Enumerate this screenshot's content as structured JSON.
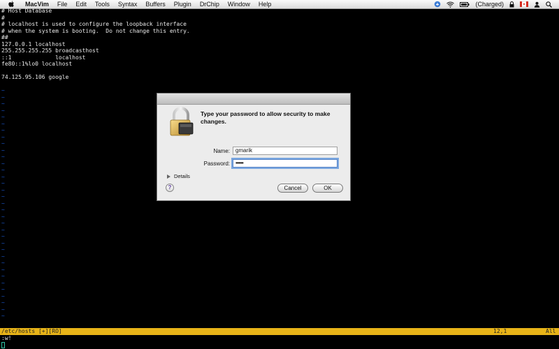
{
  "menubar": {
    "app_name": "MacVim",
    "items": [
      "File",
      "Edit",
      "Tools",
      "Syntax",
      "Buffers",
      "Plugin",
      "DrChip",
      "Window",
      "Help"
    ],
    "battery_text": "(Charged)"
  },
  "buffer": {
    "lines": [
      "# Host Database",
      "#",
      "# localhost is used to configure the loopback interface",
      "# when the system is booting.  Do not change this entry.",
      "##",
      "127.0.0.1 localhost",
      "255.255.255.255 broadcasthost",
      "::1             localhost",
      "fe80::1%lo0 localhost",
      "",
      "74.125.95.106 google"
    ],
    "tilde_count": 35,
    "tilde_char": "~"
  },
  "statusline": {
    "filename": "/etc/hosts [+][RO]",
    "position": "12,1",
    "percent": "All"
  },
  "cmdline": ":w!",
  "dialog": {
    "message": "Type your password to allow security to make changes.",
    "name_label": "Name:",
    "name_value": "gmarik",
    "password_label": "Password:",
    "password_value": "••••••",
    "details_label": "Details",
    "help_label": "?",
    "cancel_label": "Cancel",
    "ok_label": "OK"
  },
  "colors": {
    "status_bar": "#e8b418",
    "tilde": "#1a55c8",
    "cursor": "#2ec4a6"
  }
}
